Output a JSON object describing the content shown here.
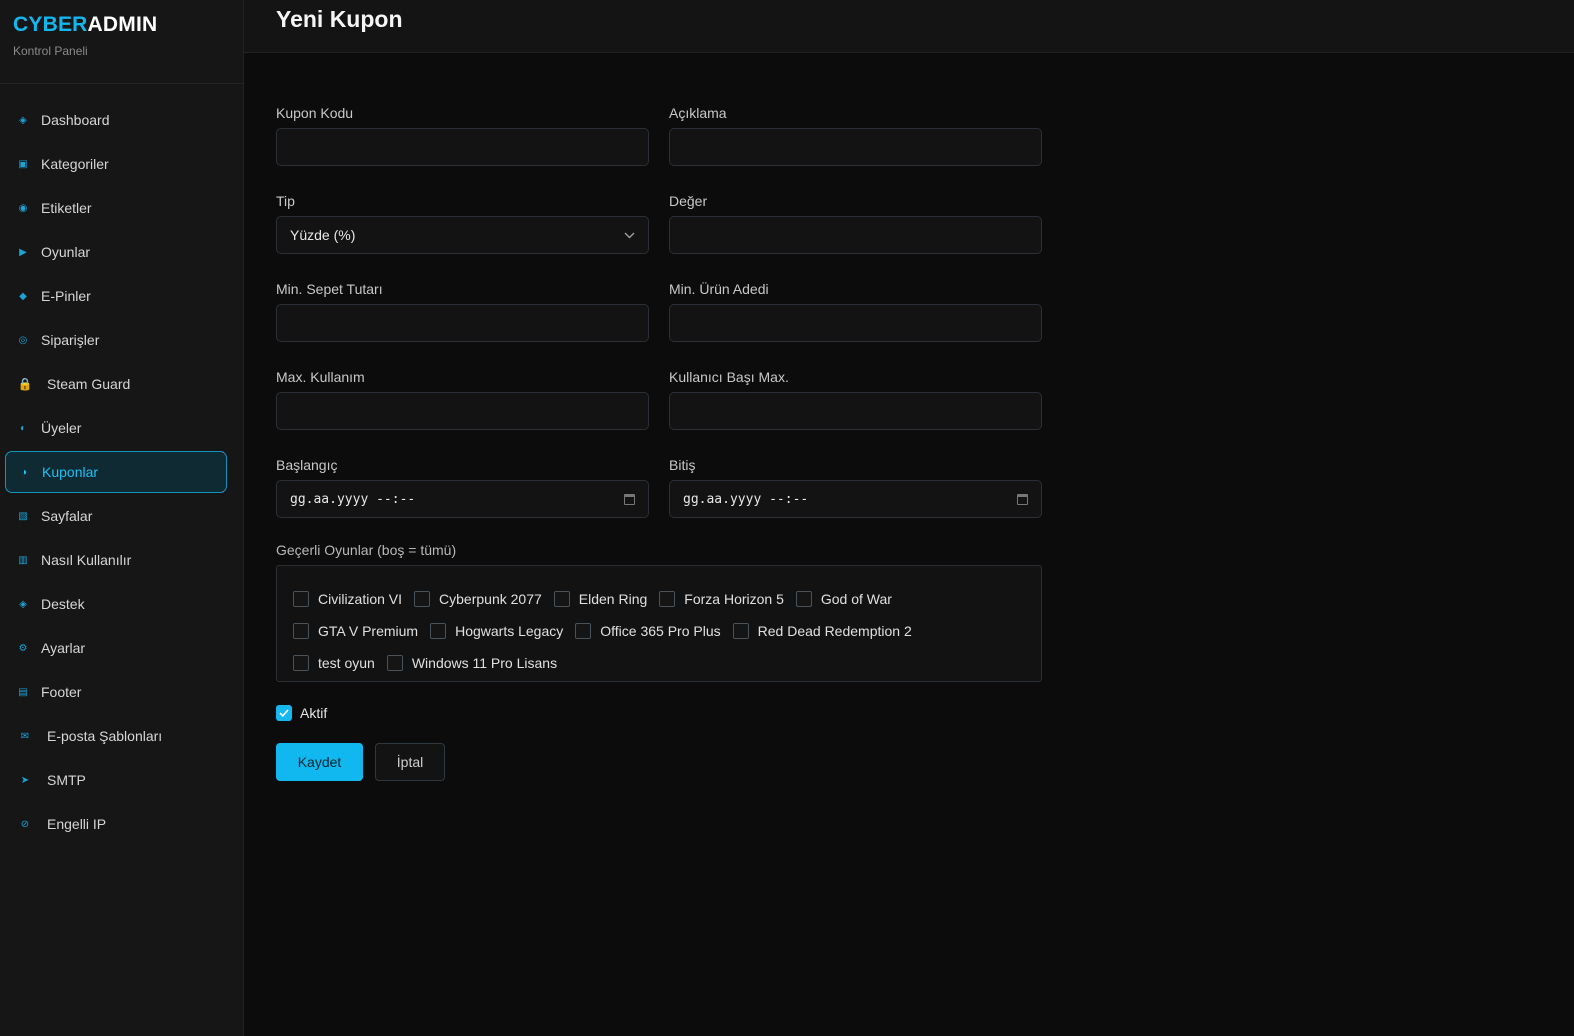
{
  "brand": {
    "part1": "CYBER",
    "part2": "ADMIN",
    "subtitle": "Kontrol Paneli"
  },
  "colors": {
    "accent": "#13b7ee",
    "background": "#0c0c0c",
    "sidebar": "#161616"
  },
  "nav": [
    {
      "label": "Dashboard",
      "icon": "diamond-outline-icon",
      "glyph": "◈"
    },
    {
      "label": "Kategoriler",
      "icon": "square-icon",
      "glyph": "▣"
    },
    {
      "label": "Etiketler",
      "icon": "circle-dot-icon",
      "glyph": "◉"
    },
    {
      "label": "Oyunlar",
      "icon": "play-icon",
      "glyph": "▶"
    },
    {
      "label": "E-Pinler",
      "icon": "diamond-icon",
      "glyph": "◆"
    },
    {
      "label": "Siparişler",
      "icon": "ring-icon",
      "glyph": "◎"
    },
    {
      "label": "Steam Guard",
      "icon": "lock-icon",
      "glyph": "🔒"
    },
    {
      "label": "Üyeler",
      "icon": "half-circle-icon",
      "glyph": "◐"
    },
    {
      "label": "Kuponlar",
      "icon": "half-circle-right-icon",
      "glyph": "◑",
      "active": true
    },
    {
      "label": "Sayfalar",
      "icon": "hatched-square-icon",
      "glyph": "▧"
    },
    {
      "label": "Nasıl Kullanılır",
      "icon": "grid-square-icon",
      "glyph": "▥"
    },
    {
      "label": "Destek",
      "icon": "diamond-outline-icon",
      "glyph": "◈"
    },
    {
      "label": "Ayarlar",
      "icon": "gear-icon",
      "glyph": "⚙"
    },
    {
      "label": "Footer",
      "icon": "list-square-icon",
      "glyph": "▤"
    },
    {
      "label": "E-posta Şablonları",
      "icon": "mail-icon",
      "glyph": "✉"
    },
    {
      "label": "SMTP",
      "icon": "send-icon",
      "glyph": "➤"
    },
    {
      "label": "Engelli IP",
      "icon": "block-icon",
      "glyph": "⊘"
    }
  ],
  "page": {
    "title": "Yeni Kupon"
  },
  "form": {
    "coupon_code": {
      "label": "Kupon Kodu",
      "value": ""
    },
    "description": {
      "label": "Açıklama",
      "value": ""
    },
    "type": {
      "label": "Tip",
      "value": "Yüzde (%)"
    },
    "value": {
      "label": "Değer",
      "value": ""
    },
    "min_cart": {
      "label": "Min. Sepet Tutarı",
      "value": ""
    },
    "min_items": {
      "label": "Min. Ürün Adedi",
      "value": ""
    },
    "max_usage": {
      "label": "Max. Kullanım",
      "value": ""
    },
    "max_per_user": {
      "label": "Kullanıcı Başı Max.",
      "value": ""
    },
    "start": {
      "label": "Başlangıç",
      "value": "gg.aa.yyyy --:--"
    },
    "end": {
      "label": "Bitiş",
      "value": "gg.aa.yyyy --:--"
    },
    "games": {
      "label": "Geçerli Oyunlar (boş = tümü)",
      "rows": [
        [
          "Civilization VI",
          "Cyberpunk 2077",
          "Elden Ring",
          "Forza Horizon 5",
          "God of War"
        ],
        [
          "GTA V Premium",
          "Hogwarts Legacy",
          "Office 365 Pro Plus",
          "Red Dead Redemption 2"
        ],
        [
          "test oyun",
          "Windows 11 Pro Lisans"
        ]
      ]
    },
    "active": {
      "label": "Aktif",
      "checked": true
    },
    "save_label": "Kaydet",
    "cancel_label": "İptal"
  }
}
